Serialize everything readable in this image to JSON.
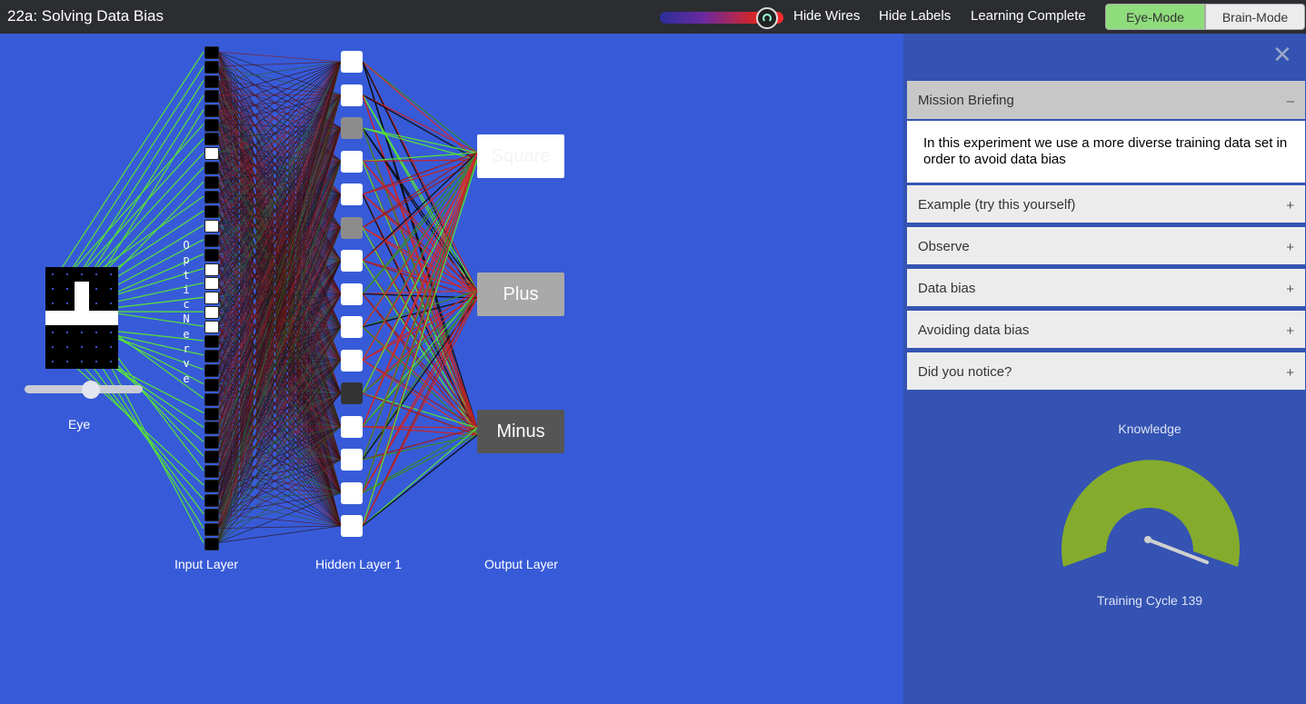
{
  "app": {
    "title": "22a: Solving Data Bias"
  },
  "toolbar": {
    "hide_wires": "Hide Wires",
    "hide_labels": "Hide Labels",
    "learning_status": "Learning Complete",
    "eye_mode": "Eye-Mode",
    "brain_mode": "Brain-Mode"
  },
  "network": {
    "optic_nerve": "Optic Nerve",
    "eye_label": "Eye",
    "eye_pixels": [
      [
        0,
        0,
        0,
        0,
        0
      ],
      [
        0,
        0,
        1,
        0,
        0
      ],
      [
        0,
        0,
        1,
        0,
        0
      ],
      [
        1,
        1,
        1,
        1,
        1
      ],
      [
        0,
        0,
        0,
        0,
        0
      ],
      [
        0,
        0,
        0,
        0,
        0
      ],
      [
        0,
        0,
        0,
        0,
        0
      ]
    ],
    "input_label": "Input Layer",
    "hidden_label": "Hidden Layer 1",
    "output_label": "Output Layer",
    "outputs": [
      "Square",
      "Plus",
      "Minus"
    ]
  },
  "panel": {
    "close_icon": "close-icon",
    "briefing_title": "Mission Briefing",
    "briefing_toggle": "–",
    "briefing_text": "In this experiment we use a more diverse training data set in order to avoid data bias",
    "sections": [
      {
        "label": "Example (try this yourself)",
        "toggle": "+"
      },
      {
        "label": "Observe",
        "toggle": "+"
      },
      {
        "label": "Data bias",
        "toggle": "+"
      },
      {
        "label": "Avoiding data bias",
        "toggle": "+"
      },
      {
        "label": "Did you notice?",
        "toggle": "+"
      }
    ],
    "gauge_title": "Knowledge",
    "gauge_footer": "Training Cycle 139"
  },
  "colors": {
    "background": "#375bd8",
    "gauge_fill": "#85ab2d",
    "wire_green": "#57e23a",
    "wire_red": "#c7262a"
  }
}
